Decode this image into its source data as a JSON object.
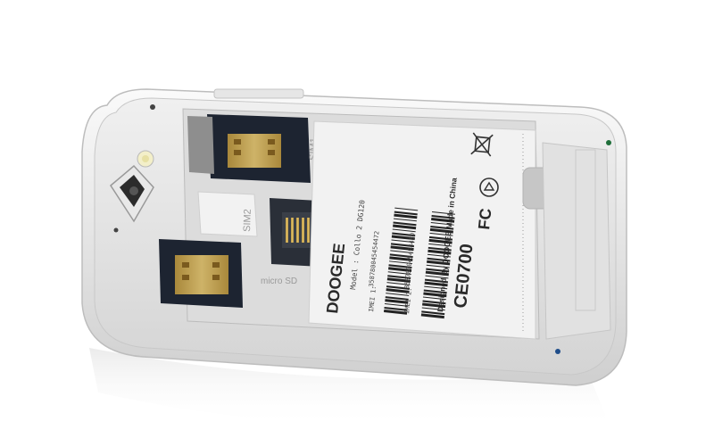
{
  "scene": {
    "description_visible": false,
    "colors": {
      "background": "#ffffff",
      "phone_body": "#e3e3e3",
      "phone_rim": "#f4f4f4",
      "pcb": "#1d2431",
      "gold": "#c9a24a",
      "sticker": "#f2f2f2"
    }
  },
  "slots": {
    "sim1_label": "SIM1",
    "sim2_label": "SIM2",
    "microsd_label": "micro SD"
  },
  "sticker": {
    "brand": "DOOGEE",
    "model_line": "Model : Collo 2 DG120",
    "made_in": "Designed By DOOGEE Made in China",
    "imei1_label": "IMEI 1:",
    "imei1_value": "358780045454472",
    "imei2_label": "IMEI 2:",
    "imei2_value": "358780045454480",
    "ce_mark": "CE0700",
    "fc_mark": "FC"
  },
  "icons": {
    "camera": "camera-lens-icon",
    "flash": "flash-led-icon",
    "weee": "crossed-bin-icon",
    "recycle": "recycle-icon",
    "alert": "alert-circle-icon"
  }
}
